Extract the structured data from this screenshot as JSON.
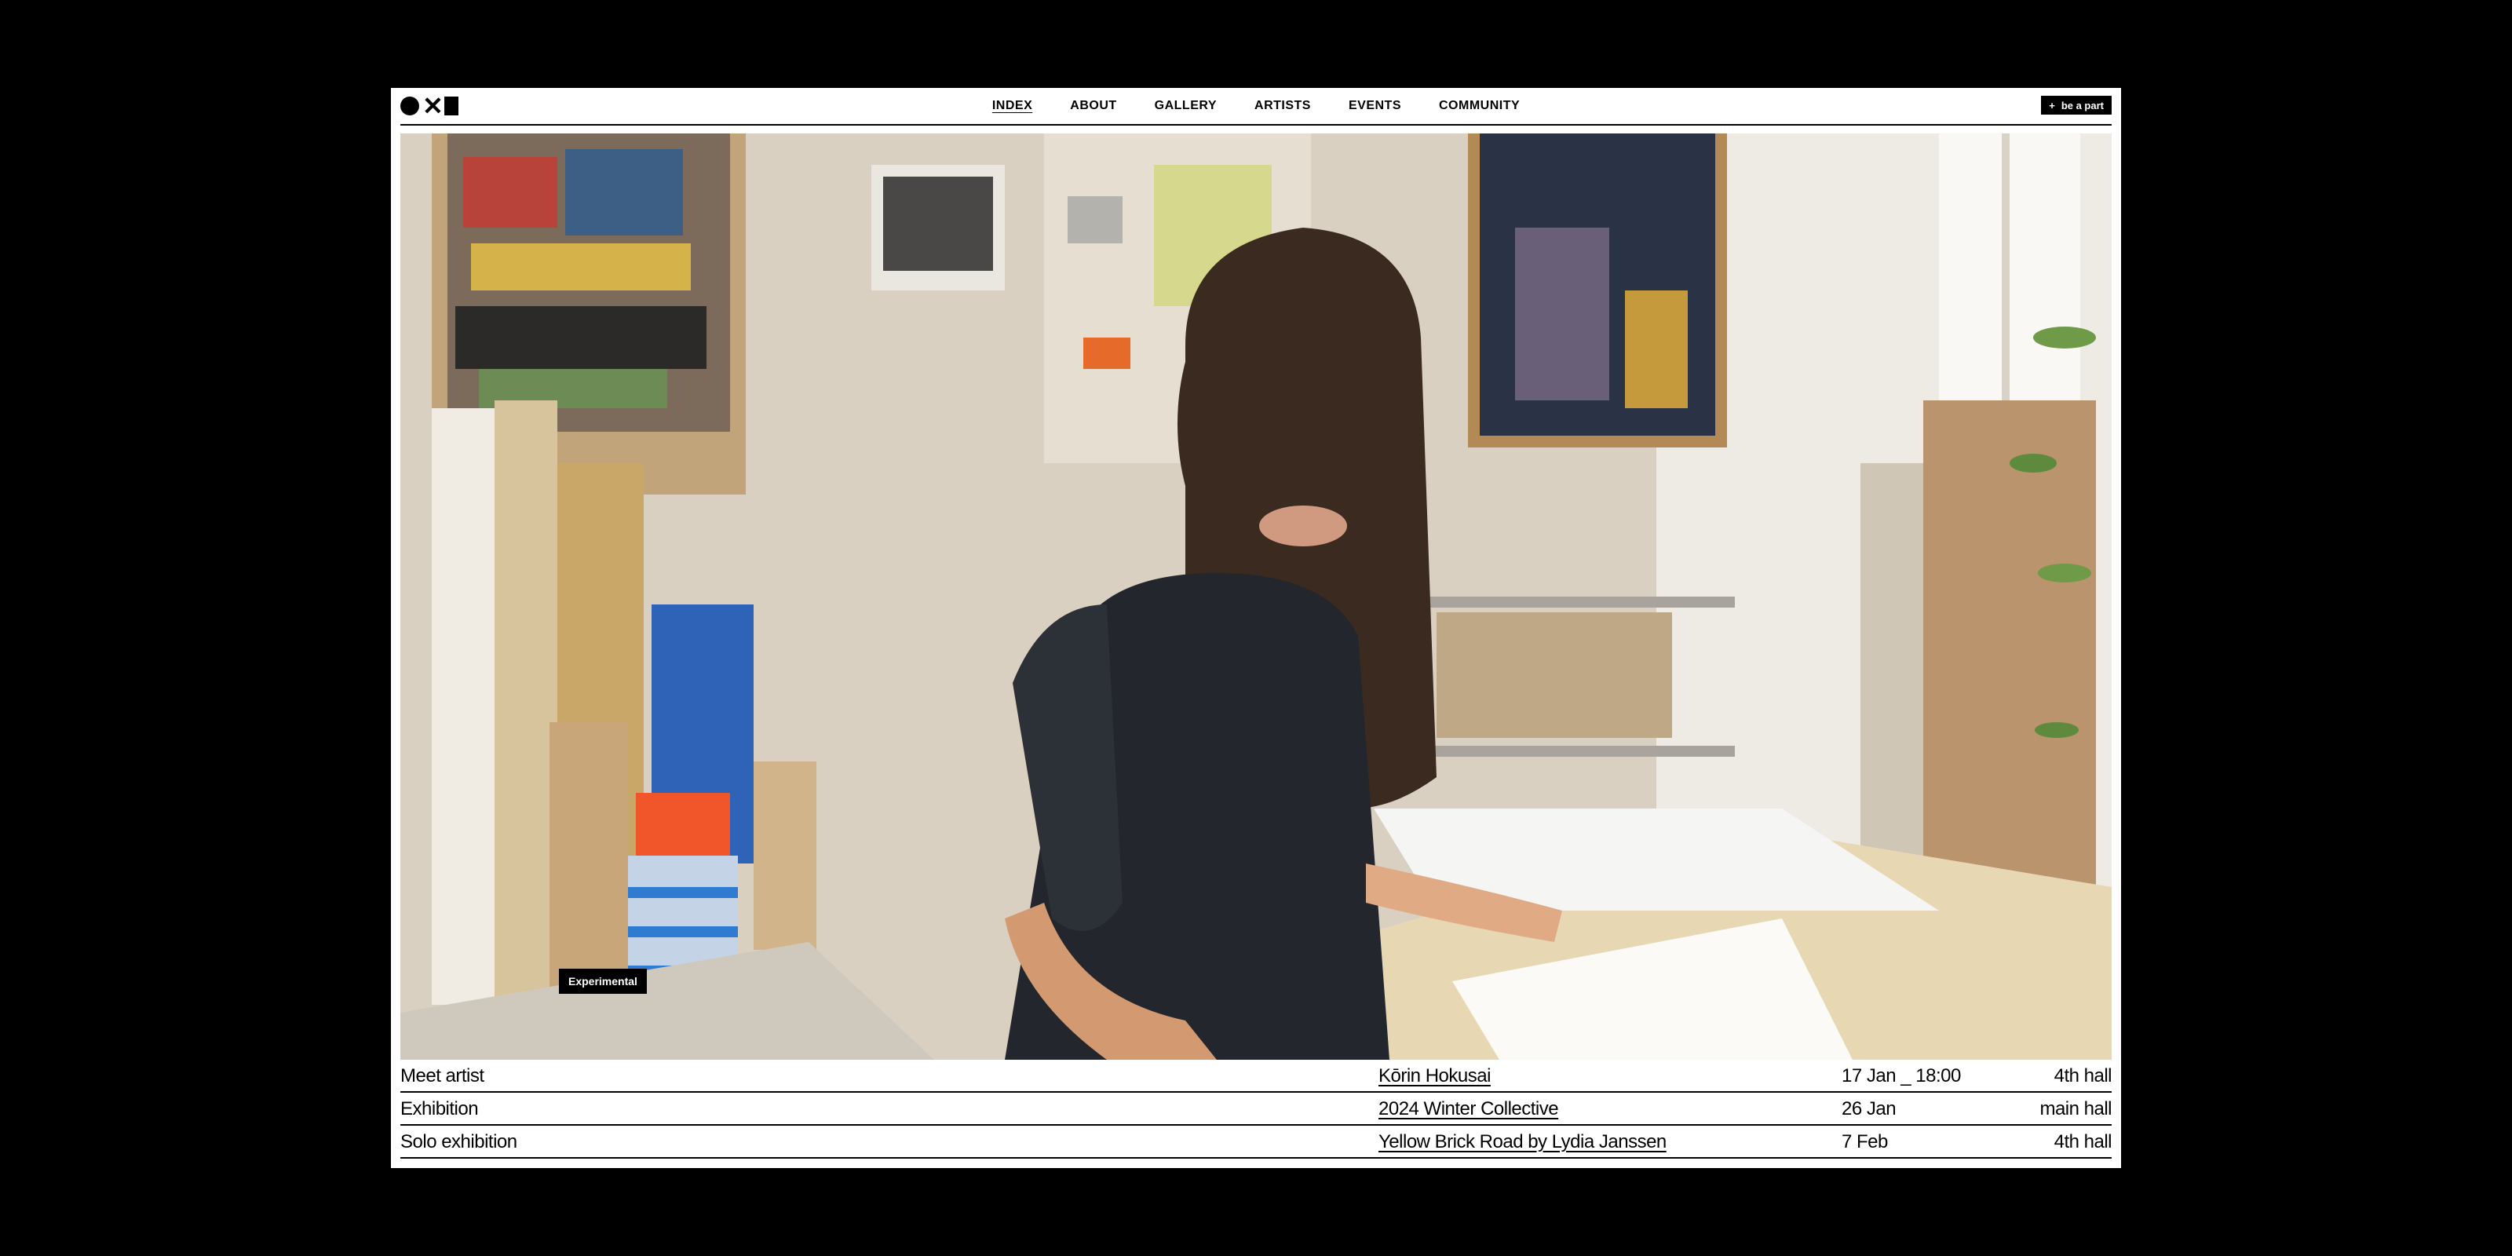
{
  "header": {
    "logo_label": "oxblack logo",
    "nav": [
      {
        "label": "INDEX",
        "active": true
      },
      {
        "label": "ABOUT"
      },
      {
        "label": "GALLERY"
      },
      {
        "label": "ARTISTS"
      },
      {
        "label": "EVENTS"
      },
      {
        "label": "COMMUNITY"
      }
    ],
    "cta": {
      "icon": "+",
      "label": "be a part"
    }
  },
  "hero": {
    "tag": "Experimental",
    "image_description": "photo"
  },
  "events": [
    {
      "type": "Meet artist",
      "name": "Kōrin Hokusai",
      "date": "17 Jan _ 18:00",
      "place": "4th hall"
    },
    {
      "type": "Exhibition",
      "name": "2024 Winter Collective",
      "date": "26 Jan",
      "place": "main hall"
    },
    {
      "type": "Solo exhibition",
      "name": "Yellow Brick Road by Lydia Janssen ",
      "date": "7 Feb",
      "place": "4th hall"
    }
  ],
  "colors": {
    "background": "#000000",
    "surface": "#ffffff",
    "ink": "#000000"
  }
}
